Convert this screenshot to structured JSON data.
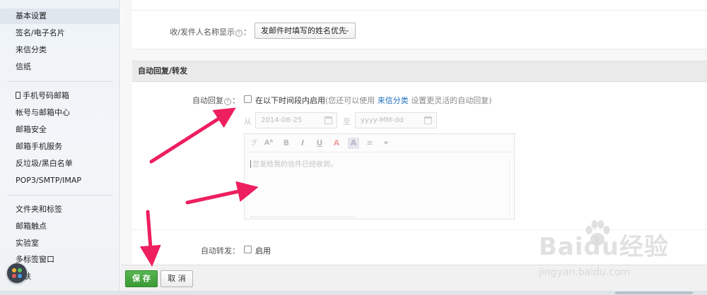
{
  "sidebar": {
    "group1": [
      {
        "label": "基本设置",
        "active": true
      },
      {
        "label": "签名/电子名片"
      },
      {
        "label": "来信分类"
      },
      {
        "label": "信纸"
      }
    ],
    "group2": [
      {
        "label": "手机号码邮箱",
        "icon": "phone-icon"
      },
      {
        "label": "帐号与邮箱中心"
      },
      {
        "label": "邮箱安全"
      },
      {
        "label": "邮箱手机服务"
      },
      {
        "label": "反垃圾/黑白名单"
      },
      {
        "label": "POP3/SMTP/IMAP"
      }
    ],
    "group3": [
      {
        "label": "文件夹和标签"
      },
      {
        "label": "邮箱触点"
      },
      {
        "label": "实验室"
      },
      {
        "label": "多标签窗口"
      },
      {
        "label": "换肤"
      }
    ]
  },
  "sender_display": {
    "label": "收/发件人名称显示",
    "help": "?",
    "colon": "：",
    "selected": "发邮件时填写的姓名优先",
    "chevron": "⌄"
  },
  "auto_reply_section": {
    "title": "自动回复/转发",
    "reply_label": "自动回复",
    "help": "?",
    "colon": "：",
    "checkbox_label": "在以下时间段内启用",
    "hint_prefix": "(您还可以使用",
    "hint_link": "来信分类",
    "hint_suffix": "设置更灵活的自动回复)",
    "from_label": "从",
    "start_date": "2014-08-25",
    "to_label": "至",
    "end_date_placeholder": "yyyy-MM-dd",
    "editor_placeholder": "您发给我的信件已经收到。",
    "toolbar_icons": [
      "font-family-icon",
      "font-size-icon",
      "bold-icon",
      "italic-icon",
      "underline-icon",
      "text-color-icon",
      "background-color-icon",
      "align-icon",
      "link-icon"
    ],
    "toolbar_glyphs": [
      "ℱ",
      "Aᴬ",
      "B",
      "I",
      "U",
      "A",
      "A",
      "≡",
      "⚭"
    ]
  },
  "auto_forward": {
    "label": "自动转发",
    "colon": "：",
    "checkbox_label": "启用"
  },
  "actions": {
    "save": "保 存",
    "cancel": "取 消"
  },
  "watermark": {
    "brand": "Baidu经验",
    "url": "jingyan.baidu.com"
  },
  "colors": {
    "arrow": "#ee1f5f",
    "save_button": "#46a83f",
    "link": "#1f6fbf"
  }
}
